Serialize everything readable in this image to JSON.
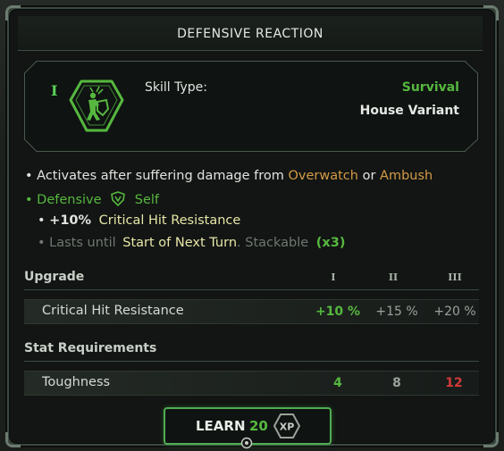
{
  "title": "DEFENSIVE REACTION",
  "skill": {
    "rank": "I",
    "icon": "survival-shield-figure-icon",
    "type_label": "Skill Type:",
    "type_value": "Survival",
    "variant": "House Variant"
  },
  "description": {
    "line1_prefix": "• Activates after suffering damage from",
    "trigger1": "Overwatch",
    "connector": "or",
    "trigger2": "Ambush",
    "line2_prefix": "•",
    "tag": "Defensive",
    "target": "Self",
    "effect_bullet": "•",
    "effect_value": "+10%",
    "effect_stat": "Critical Hit Resistance",
    "duration_prefix": "• Lasts until",
    "duration_value": "Start of Next Turn",
    "stack_text": ". Stackable",
    "stack_count": "(x3)"
  },
  "upgrade": {
    "header": "Upgrade",
    "levels": [
      "I",
      "II",
      "III"
    ],
    "stat": "Critical Hit Resistance",
    "values": [
      "+10 %",
      "+15 %",
      "+20 %"
    ]
  },
  "requirements": {
    "header": "Stat Requirements",
    "stat": "Toughness",
    "values": [
      "4",
      "8",
      "12"
    ]
  },
  "learn": {
    "label": "LEARN",
    "cost": "20",
    "currency": "XP"
  },
  "colors": {
    "accent_green": "#56b83f",
    "trigger_orange": "#d49a46",
    "highlight_yellow": "#e8e6a8",
    "unmet_red": "#d23a3a"
  }
}
